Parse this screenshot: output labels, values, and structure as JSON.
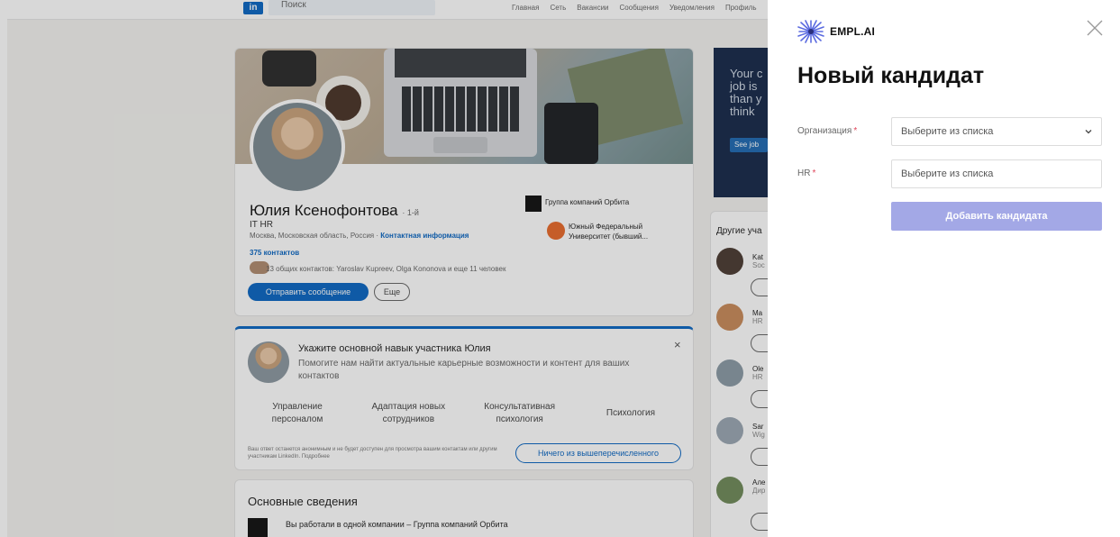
{
  "background": {
    "search_placeholder": "Поиск",
    "nav": [
      "Главная",
      "Сеть",
      "Вакансии",
      "Сообщения",
      "Уведомления",
      "Профиль"
    ],
    "profile": {
      "name": "Юлия Ксенофонтова",
      "degree": "· 1-й",
      "role": "IT HR",
      "location": "Москва, Московская область, Россия ·",
      "contact_info": "Контактная информация",
      "connections": "375 контактов",
      "mutual": "13 общих контактов: Yaroslav Kupreev, Olga Kononova и еще 11 человек",
      "message_button": "Отправить сообщение",
      "more_button": "Еще",
      "company": "Группа компаний Орбита",
      "university": "Южный Федеральный Университет (бывший..."
    },
    "skill_prompt": {
      "title": "Укажите основной навык участника Юлия",
      "subtitle": "Помогите нам найти актуальные карьерные возможности и контент для ваших контактов",
      "options": [
        "Управление персоналом",
        "Адаптация новых сотрудников",
        "Консультативная психология",
        "Психология"
      ],
      "note": "Ваш ответ останется анонимным и не будет доступен для просмотра вашим контактам или другим участникам LinkedIn. Подробнее",
      "none_button": "Ничего из вышеперечисленного",
      "close": "×"
    },
    "basic_info": {
      "title": "Основные сведения",
      "line": "Вы работали в одной компании – Группа компаний Орбита"
    },
    "ad": {
      "text": [
        "Your c",
        "job is",
        "than y",
        "think"
      ],
      "button": "See job"
    },
    "others": {
      "heading": "Другие уча",
      "people": [
        {
          "name": "Kat",
          "sub": "Soc"
        },
        {
          "name": "Ma",
          "sub": "HR"
        },
        {
          "name": "Ole",
          "sub": "HR"
        },
        {
          "name": "Sar",
          "sub": "Wig"
        },
        {
          "name": "Але",
          "sub": "Дир"
        }
      ]
    }
  },
  "modal": {
    "logo_text": "EMPL.AI",
    "title": "Новый кандидат",
    "organization": {
      "label": "Организация",
      "required_mark": "*",
      "placeholder": "Выберите из списка"
    },
    "hr": {
      "label": "HR",
      "required_mark": "*",
      "placeholder": "Выберите из списка"
    },
    "submit_label": "Добавить кандидата",
    "colors": {
      "submit_bg": "#a3a8e6",
      "required": "#e0455a",
      "logo_accent": "#5b6be0"
    }
  }
}
